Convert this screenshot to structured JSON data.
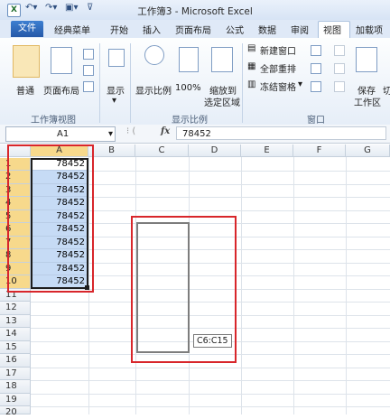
{
  "window": {
    "title": "工作簿3 - Microsoft Excel",
    "app_icon": "X"
  },
  "ribbon_tabs": [
    "文件",
    "经典菜单",
    "开始",
    "插入",
    "页面布局",
    "公式",
    "数据",
    "审阅",
    "视图",
    "加载项"
  ],
  "ribbon": {
    "normal": "普通",
    "page_layout": "页面布局",
    "show": "显示",
    "zoom": "显示比例",
    "zoom_100": "100%",
    "zoom_to_1": "缩放到",
    "zoom_to_2": "选定区域",
    "new_window": "新建窗口",
    "arrange_all": "全部重排",
    "freeze_panes": "冻结窗格",
    "save": "保存",
    "workspace": "工作区",
    "switch": "切",
    "group_workbook_views": "工作簿视图",
    "group_zoom": "显示比例",
    "group_window": "窗口"
  },
  "formula_bar": {
    "name_box": "A1",
    "fx": "fx",
    "value": "78452"
  },
  "columns": [
    "A",
    "B",
    "C",
    "D",
    "E",
    "F",
    "G"
  ],
  "rows": [
    "1",
    "2",
    "3",
    "4",
    "5",
    "6",
    "7",
    "8",
    "9",
    "10",
    "11",
    "12",
    "13",
    "14",
    "15",
    "16",
    "17",
    "18",
    "19",
    "20"
  ],
  "column_a_values": [
    "78452",
    "78452",
    "78452",
    "78452",
    "78452",
    "78452",
    "78452",
    "78452",
    "78452",
    "78452"
  ],
  "drag_tooltip": "C6:C15",
  "colors": {
    "selection": "#c6dbf5",
    "highlight": "#d8262b",
    "header_selected": "#f7d98c"
  }
}
